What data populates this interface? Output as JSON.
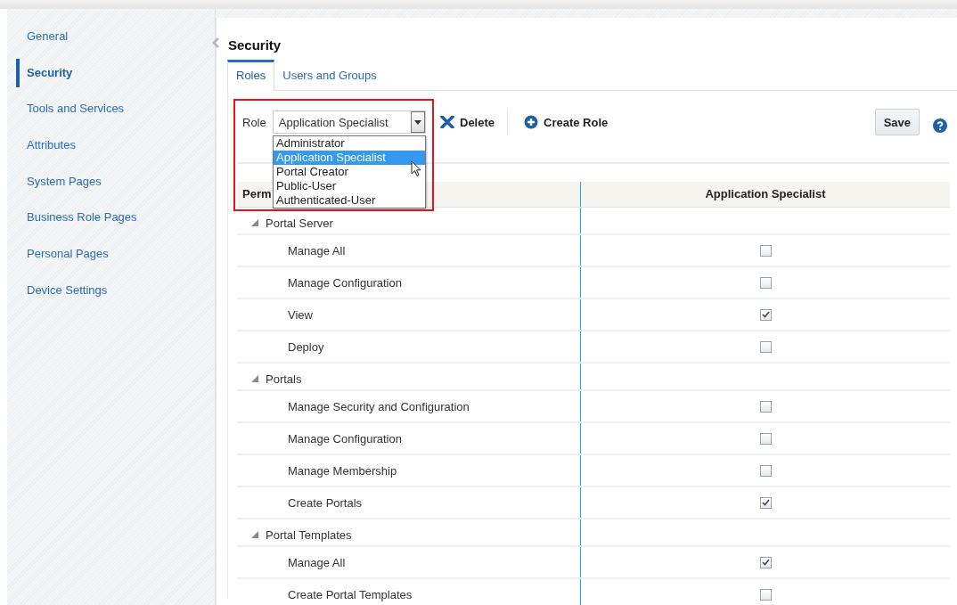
{
  "sidebar": {
    "items": [
      {
        "label": "General",
        "selected": false
      },
      {
        "label": "Security",
        "selected": true
      },
      {
        "label": "Tools and Services",
        "selected": false
      },
      {
        "label": "Attributes",
        "selected": false
      },
      {
        "label": "System Pages",
        "selected": false
      },
      {
        "label": "Business Role Pages",
        "selected": false
      },
      {
        "label": "Personal Pages",
        "selected": false
      },
      {
        "label": "Device Settings",
        "selected": false
      }
    ]
  },
  "page": {
    "title": "Security"
  },
  "tabs": [
    {
      "label": "Roles",
      "selected": true
    },
    {
      "label": "Users and Groups",
      "selected": false
    }
  ],
  "toolbar": {
    "role_label": "Role",
    "role_value": "Application Specialist",
    "delete": "Delete",
    "create": "Create Role",
    "save": "Save"
  },
  "role_dropdown": {
    "expanded": true,
    "options": [
      {
        "label": "Administrator",
        "selected": false
      },
      {
        "label": "Application Specialist",
        "selected": true
      },
      {
        "label": "Portal Creator",
        "selected": false
      },
      {
        "label": "Public-User",
        "selected": false
      },
      {
        "label": "Authenticated-User",
        "selected": false
      }
    ]
  },
  "table": {
    "columns": [
      "Perm",
      "Application Specialist"
    ],
    "rows": [
      {
        "label": "Portal Server",
        "expanded": true,
        "children": [
          {
            "label": "Manage All",
            "checked": false
          },
          {
            "label": "Manage Configuration",
            "checked": false
          },
          {
            "label": "View",
            "checked": true
          },
          {
            "label": "Deploy",
            "checked": false
          }
        ]
      },
      {
        "label": "Portals",
        "expanded": true,
        "children": [
          {
            "label": "Manage Security and Configuration",
            "checked": false
          },
          {
            "label": "Manage Configuration",
            "checked": false
          },
          {
            "label": "Manage Membership",
            "checked": false
          },
          {
            "label": "Create Portals",
            "checked": true
          }
        ]
      },
      {
        "label": "Portal Templates",
        "expanded": true,
        "children": [
          {
            "label": "Manage All",
            "checked": true
          },
          {
            "label": "Create Portal Templates",
            "checked": false
          }
        ]
      }
    ]
  }
}
